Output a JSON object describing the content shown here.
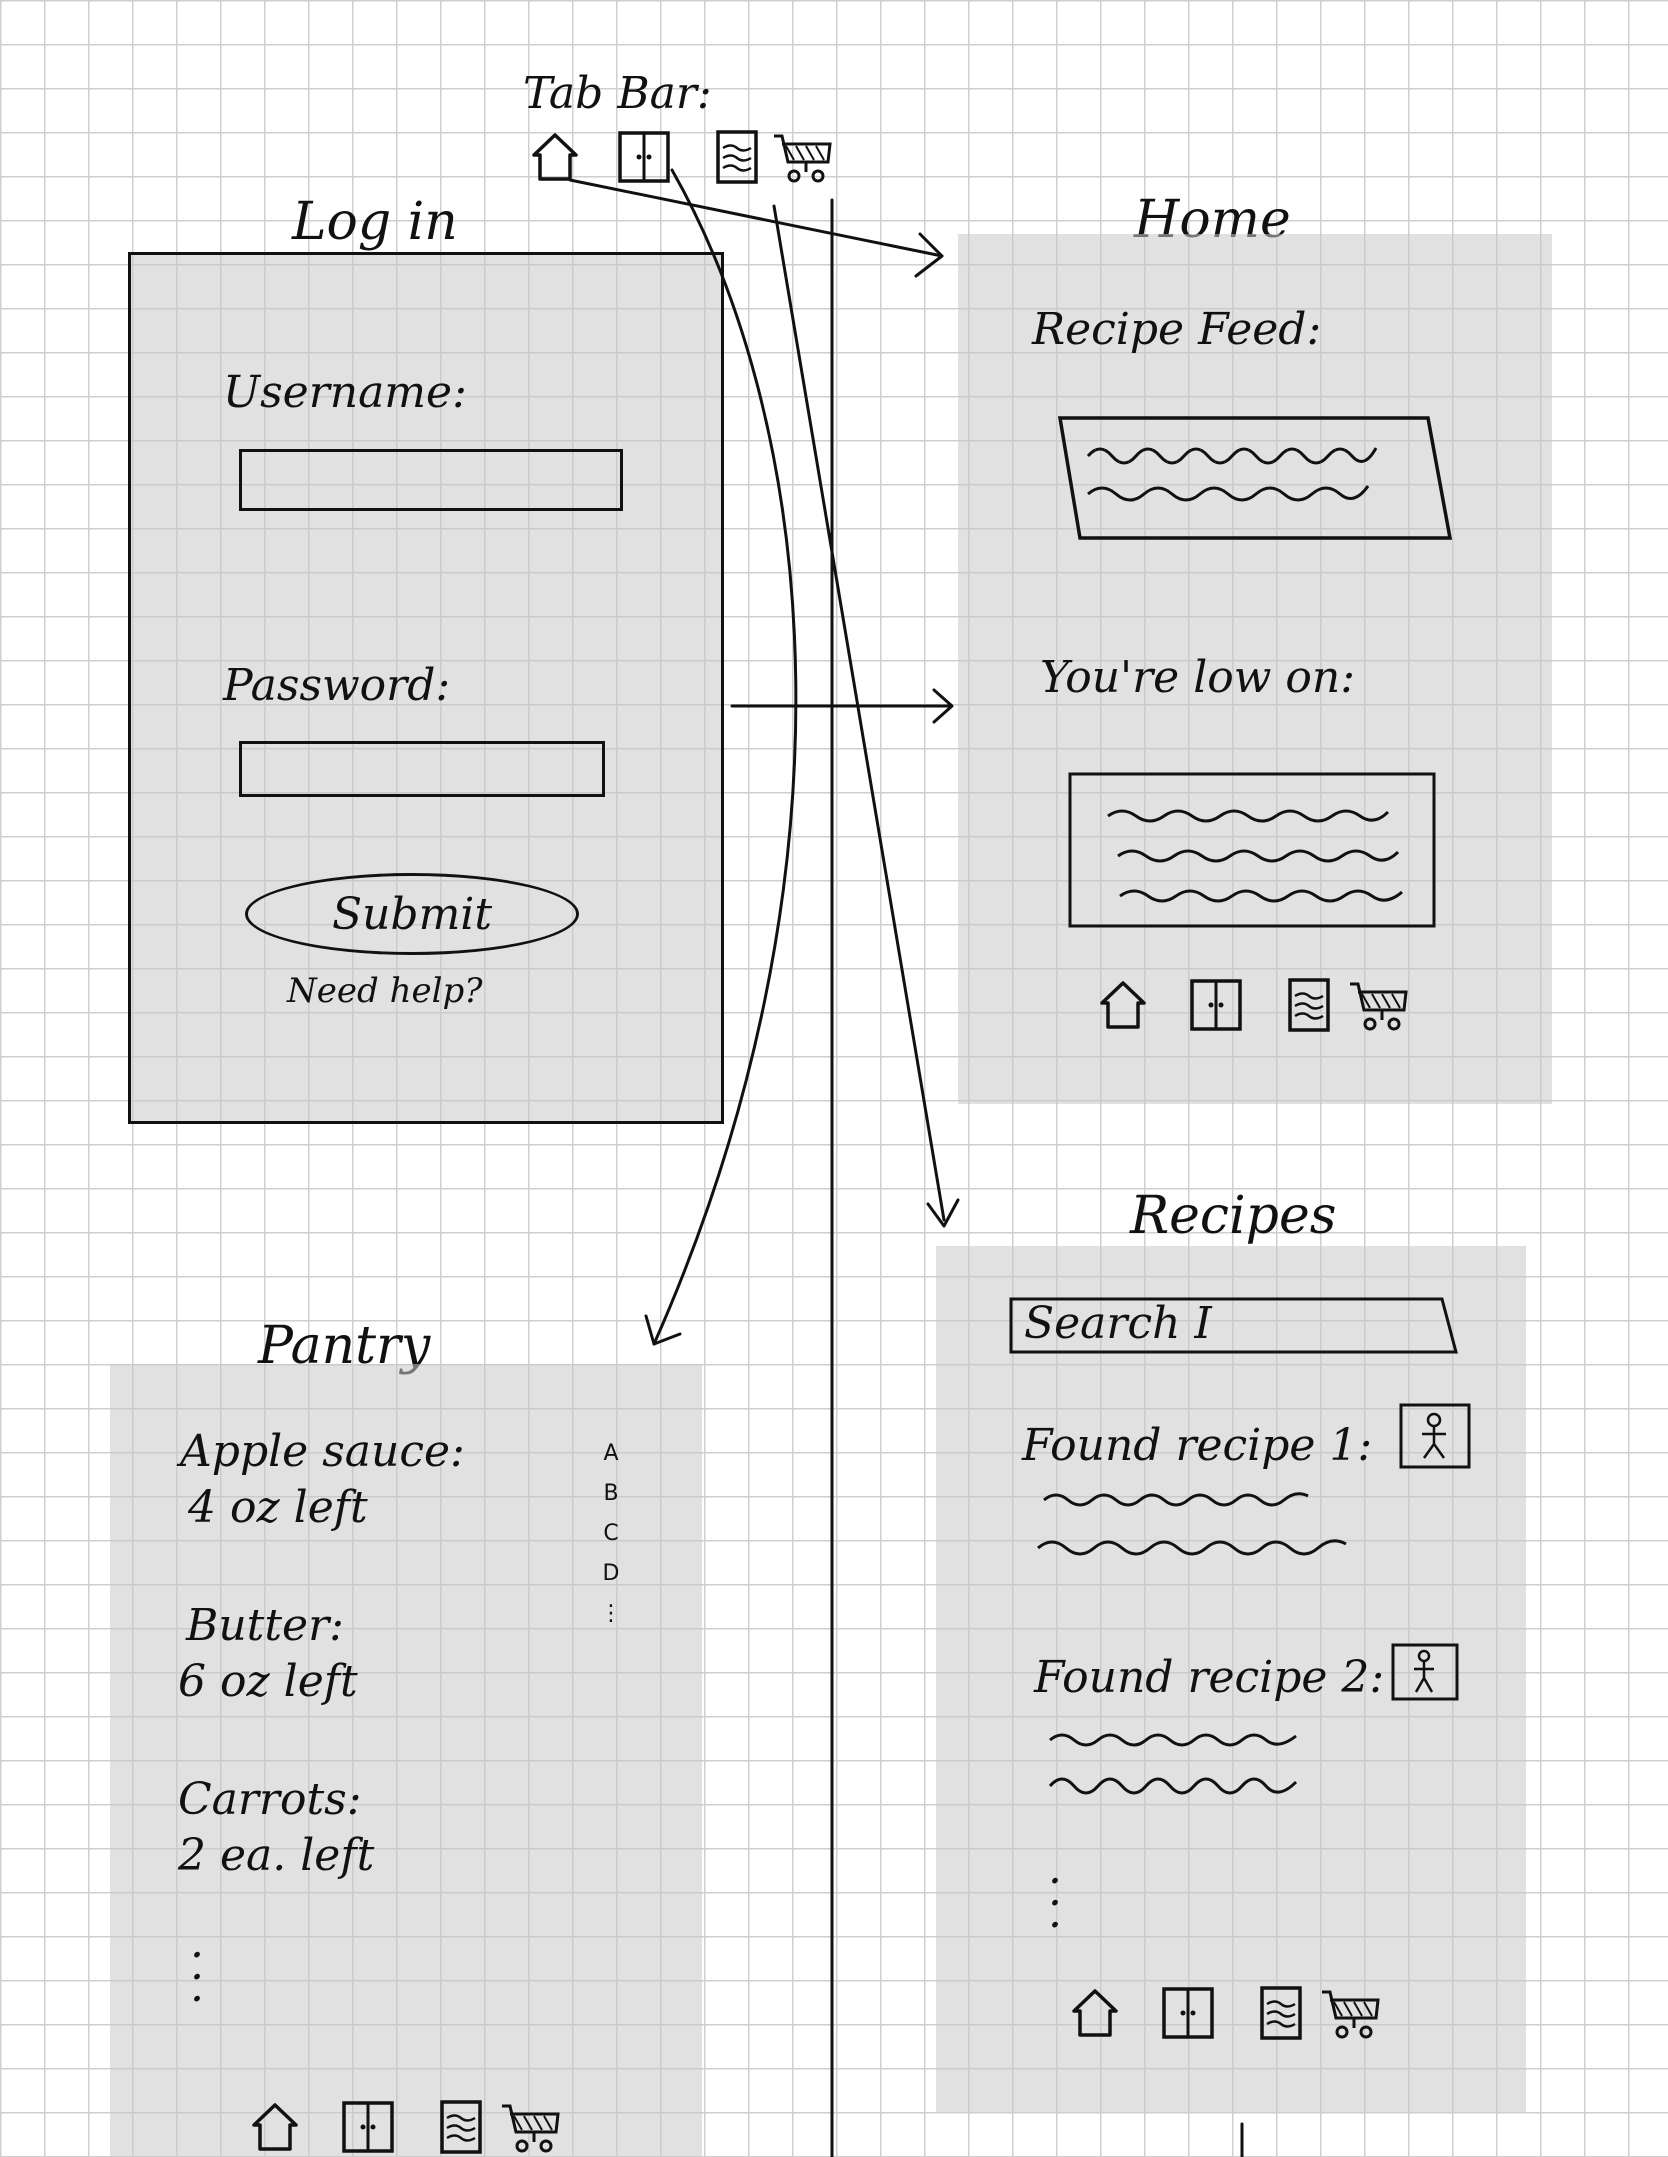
{
  "tab_bar": {
    "label": "Tab Bar:",
    "icons": [
      "home-icon",
      "pantry-icon",
      "recipes-icon",
      "cart-icon"
    ]
  },
  "login": {
    "title": "Log in",
    "username_label": "Username:",
    "password_label": "Password:",
    "submit_label": "Submit",
    "help_link": "Need help?"
  },
  "home": {
    "title": "Home",
    "recipe_feed_label": "Recipe Feed:",
    "low_on_label": "You're low on:"
  },
  "pantry": {
    "title": "Pantry",
    "items": [
      {
        "name": "Apple sauce:",
        "qty": "4 oz left"
      },
      {
        "name": "Butter:",
        "qty": "6 oz left"
      },
      {
        "name": "Carrots:",
        "qty": "2 ea. left"
      }
    ],
    "alphabet": [
      "A",
      "B",
      "C",
      "D",
      "⋮"
    ]
  },
  "recipes": {
    "title": "Recipes",
    "search_placeholder": "Search I",
    "results": [
      {
        "title": "Found recipe 1:"
      },
      {
        "title": "Found recipe 2:"
      }
    ]
  },
  "colors": {
    "screen_fill": "#d9d9d9",
    "ink": "#111111",
    "grid": "#cfcfcf"
  }
}
